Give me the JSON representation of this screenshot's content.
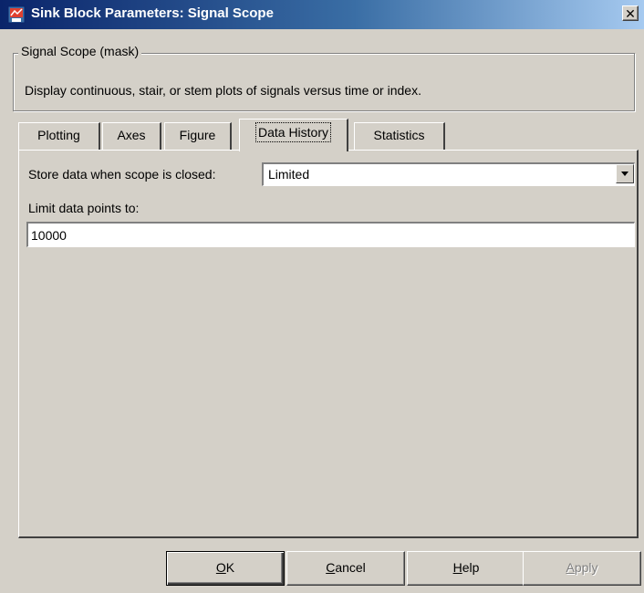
{
  "window": {
    "title": "Sink Block Parameters: Signal Scope",
    "close_label": "✕"
  },
  "group": {
    "legend": "Signal Scope (mask)",
    "description": "Display continuous, stair, or stem plots of signals versus time or index."
  },
  "tabs": [
    {
      "label": "Plotting",
      "active": false
    },
    {
      "label": "Axes",
      "active": false
    },
    {
      "label": "Figure",
      "active": false
    },
    {
      "label": "Data History",
      "active": true
    },
    {
      "label": "Statistics",
      "active": false
    }
  ],
  "panel": {
    "store_label": "Store data when scope is closed:",
    "store_value": "Limited",
    "limit_label": "Limit data points to:",
    "limit_value": "10000"
  },
  "buttons": {
    "ok": {
      "mnemonic": "O",
      "rest": "K"
    },
    "cancel": {
      "mnemonic": "C",
      "rest": "ancel"
    },
    "help": {
      "mnemonic": "H",
      "rest": "elp"
    },
    "apply": {
      "mnemonic": "A",
      "rest": "pply"
    }
  },
  "colors": {
    "titlebar_start": "#0a246a",
    "titlebar_end": "#a6caf0",
    "face": "#d4d0c8"
  }
}
